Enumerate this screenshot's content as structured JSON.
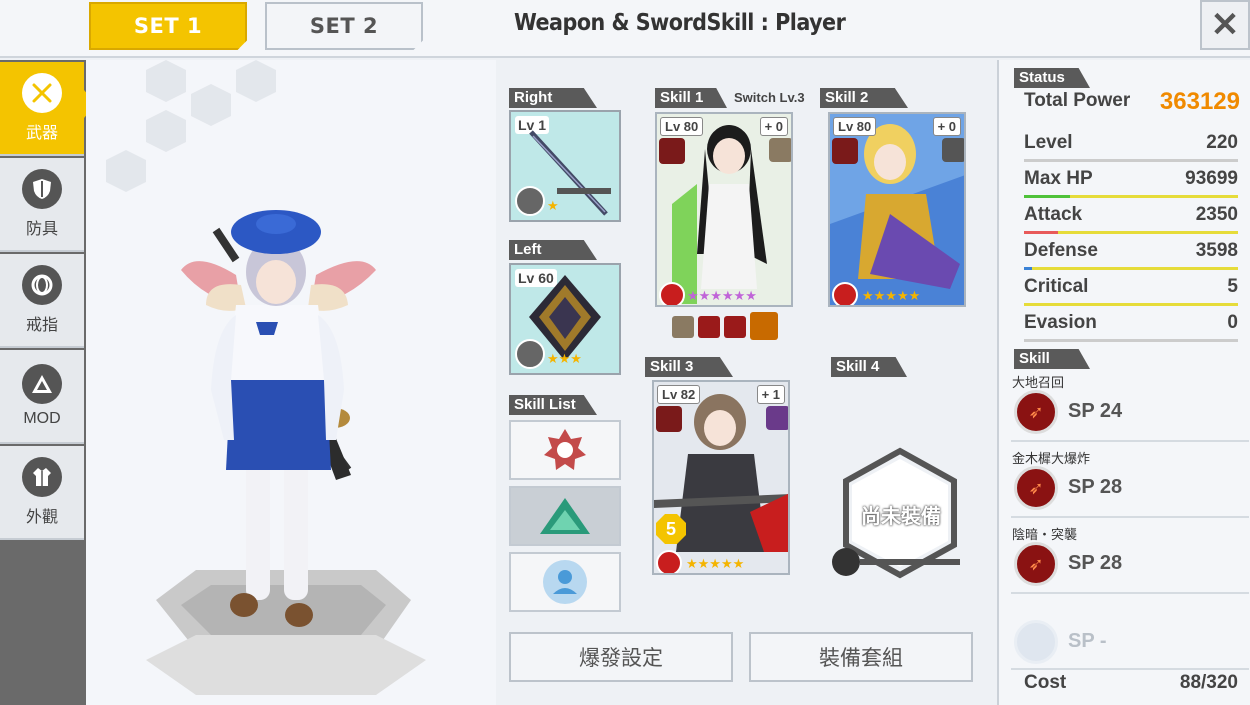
{
  "top": {
    "set1_label": "SET 1",
    "set2_label": "SET 2",
    "title": "Weapon & SwordSkill : Player",
    "close_glyph": "✕"
  },
  "nav": [
    {
      "label": "武器",
      "icon": "sword-icon"
    },
    {
      "label": "防具",
      "icon": "shield-icon"
    },
    {
      "label": "戒指",
      "icon": "ring-icon"
    },
    {
      "label": "MOD",
      "icon": "mod-icon"
    },
    {
      "label": "外觀",
      "icon": "outfit-icon"
    }
  ],
  "weapons": {
    "right_label": "Right",
    "right_lv": "Lv 1",
    "right_stars": "★",
    "left_label": "Left",
    "left_lv": "Lv 60",
    "left_stars": "★★★",
    "skill_list_label": "Skill List"
  },
  "skills": {
    "s1_label": "Skill 1",
    "s1_switch": "Switch Lv.3",
    "s1_lv": "Lv 80",
    "s1_plus": "+ 0",
    "s1_stars": "★★★★★★",
    "s2_label": "Skill 2",
    "s2_lv": "Lv 80",
    "s2_plus": "+ 0",
    "s2_stars": "★★★★★",
    "s3_label": "Skill 3",
    "s3_lv": "Lv 82",
    "s3_plus": "+ 1",
    "s3_stars": "★★★★★",
    "s3_badge": "5",
    "s4_label": "Skill 4",
    "s4_empty": "尚未裝備"
  },
  "buttons": {
    "burst": "爆發設定",
    "equip_set": "裝備套組"
  },
  "status": {
    "header": "Status",
    "total_power_label": "Total Power",
    "total_power": "363129",
    "rows": [
      {
        "label": "Level",
        "value": "220"
      },
      {
        "label": "Max HP",
        "value": "93699"
      },
      {
        "label": "Attack",
        "value": "2350"
      },
      {
        "label": "Defense",
        "value": "3598"
      },
      {
        "label": "Critical",
        "value": "5"
      },
      {
        "label": "Evasion",
        "value": "0"
      }
    ],
    "colors": {
      "hp": "#4fc23a",
      "attack": "#e85a5a",
      "defense": "#3a82d6",
      "yellow": "#e6dc3a"
    }
  },
  "skill_panel": {
    "header": "Skill",
    "items": [
      {
        "name": "大地召回",
        "sp": "SP 24"
      },
      {
        "name": "金木樨大爆炸",
        "sp": "SP 28"
      },
      {
        "name": "陰暗・突襲",
        "sp": "SP 28"
      },
      {
        "name": "",
        "sp": "SP -"
      }
    ],
    "cost_label": "Cost",
    "cost_value": "88/320"
  }
}
